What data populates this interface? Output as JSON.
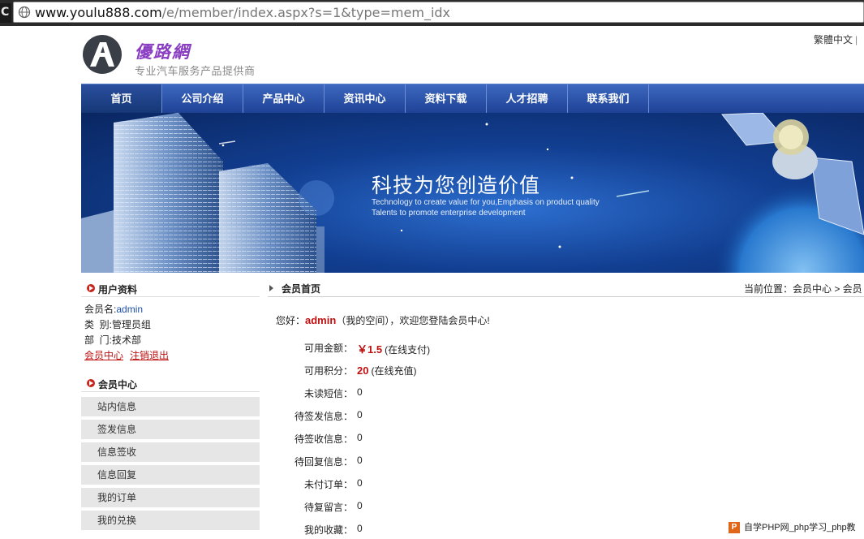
{
  "browser": {
    "back_glyph": "C",
    "url_host": "www.youlu888.com",
    "url_path": "/e/member/index.aspx?s=1&type=mem_idx"
  },
  "header": {
    "logo_title": "優路網",
    "logo_subtitle": "专业汽车服务产品提供商",
    "lang_link": "繁體中文",
    "lang_sep": "|"
  },
  "nav": {
    "items": [
      "首页",
      "公司介绍",
      "产品中心",
      "资讯中心",
      "资料下载",
      "人才招聘",
      "联系我们"
    ],
    "active_index": 0
  },
  "banner": {
    "title": "科技为您创造价值",
    "sub_line1": "Technology to create value for you,Emphasis on product quality",
    "sub_line2": "Talents to promote enterprise development"
  },
  "sidebar": {
    "profile_heading": "用户资料",
    "username_label": "会员名:",
    "username_value": "admin",
    "category_label": "类  别:",
    "category_value": "管理员组",
    "dept_label": "部  门:",
    "dept_value": "技术部",
    "link_member_center": "会员中心",
    "link_logout": "注销退出",
    "member_heading": "会员中心",
    "menu": [
      "站内信息",
      "签发信息",
      "信息签收",
      "信息回复",
      "我的订单",
      "我的兑换"
    ]
  },
  "main": {
    "heading": "会员首页",
    "breadcrumb": "当前位置：会员中心 > 会员",
    "greeting_prefix": "您好：",
    "greeting_user": "admin",
    "greeting_suffix": "（我的空间），欢迎您登陆会员中心!",
    "rows": [
      {
        "label": "可用金额：",
        "value": "￥1.5",
        "note": "(在线支付)",
        "highlight": true
      },
      {
        "label": "可用积分：",
        "value": "20",
        "note": "(在线充值)",
        "highlight": true
      },
      {
        "label": "未读短信：",
        "value": "0",
        "note": "",
        "highlight": false
      },
      {
        "label": "待签发信息：",
        "value": "0",
        "note": "",
        "highlight": false
      },
      {
        "label": "待签收信息：",
        "value": "0",
        "note": "",
        "highlight": false
      },
      {
        "label": "待回复信息：",
        "value": "0",
        "note": "",
        "highlight": false
      },
      {
        "label": "未付订单：",
        "value": "0",
        "note": "",
        "highlight": false
      },
      {
        "label": "待复留言：",
        "value": "0",
        "note": "",
        "highlight": false
      },
      {
        "label": "我的收藏：",
        "value": "0",
        "note": "",
        "highlight": false
      }
    ]
  },
  "watermark": {
    "badge": "P",
    "text": "自学PHP网_php学习_php教"
  },
  "colors": {
    "nav_blue": "#2a52a8",
    "accent_red": "#c01010",
    "logo_purple": "#8a3ec2"
  }
}
